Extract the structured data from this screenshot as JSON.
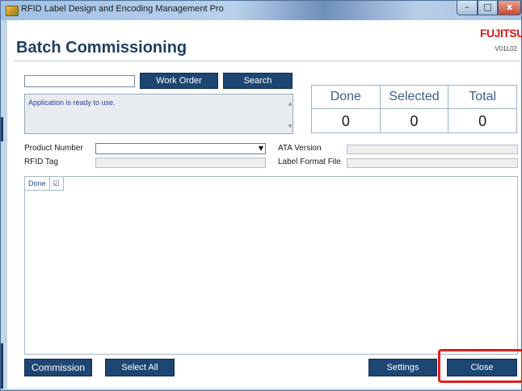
{
  "window": {
    "title": "RFID Label Design and Encoding Management Pro",
    "min_glyph": "–",
    "max_glyph": "□",
    "close_glyph": "x"
  },
  "header": {
    "title": "Batch Commissioning",
    "brand": "FUJITSU",
    "version": "V01L02"
  },
  "search": {
    "work_order_value": "",
    "work_order_label": "Work Order",
    "search_label": "Search"
  },
  "status": {
    "message": "Application is ready to use."
  },
  "counts": [
    {
      "label": "Done",
      "value": "0"
    },
    {
      "label": "Selected",
      "value": "0"
    },
    {
      "label": "Total",
      "value": "0"
    }
  ],
  "fields": {
    "product_number_label": "Product Number",
    "rfid_tag_label": "RFID Tag",
    "ata_version_label": "ATA Version",
    "label_format_file_label": "Label Format File"
  },
  "grid": {
    "columns": [
      "Done",
      "☑"
    ]
  },
  "footer": {
    "commission_label": "Commission",
    "select_all_label": "Select All",
    "settings_label": "Settings",
    "close_label": "Close"
  },
  "colors": {
    "accent": "#1d4673",
    "brand": "#d51b1b",
    "highlight": "#e01f1f"
  }
}
